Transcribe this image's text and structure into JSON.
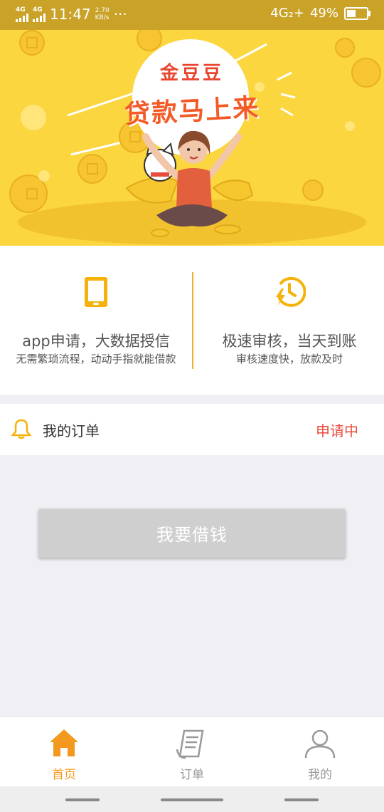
{
  "status_bar": {
    "signal1": "4G",
    "signal2": "4G",
    "time": "11:47",
    "speed_value": "2.70",
    "speed_unit": "KB/s",
    "more": "···",
    "network": "4G₂+",
    "battery": "49%"
  },
  "banner": {
    "brand": "金豆豆",
    "slogan": "贷款马上来"
  },
  "features": [
    {
      "title": "app申请，大数据授信",
      "subtitle": "无需繁琐流程，动动手指就能借款",
      "icon": "phone-icon"
    },
    {
      "title": "极速审核，当天到账",
      "subtitle": "审核速度快，放款及时",
      "icon": "clock-lightning-icon"
    }
  ],
  "order": {
    "title": "我的订单",
    "status": "申请中",
    "icon": "bell-icon"
  },
  "action": {
    "borrow_label": "我要借钱"
  },
  "tabbar": {
    "items": [
      {
        "label": "首页",
        "icon": "home-icon",
        "active": true
      },
      {
        "label": "订单",
        "icon": "receipt-icon",
        "active": false
      },
      {
        "label": "我的",
        "icon": "user-icon",
        "active": false
      }
    ]
  },
  "colors": {
    "accent": "#f0a020",
    "status_bar": "#c9a227",
    "banner_bg": "#fbd63f",
    "status_text": "#e84b3c",
    "inactive_tab": "#999999"
  }
}
